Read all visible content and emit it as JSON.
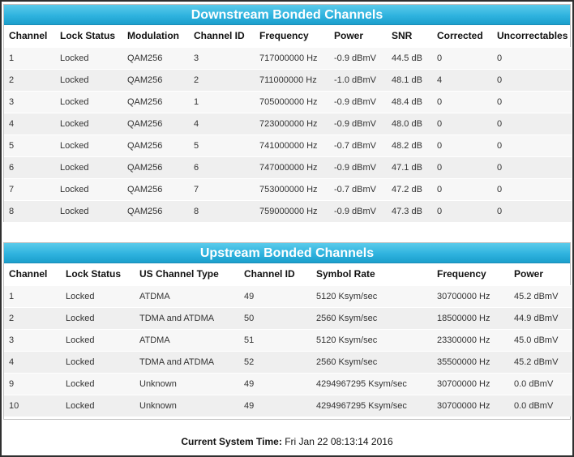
{
  "downstream": {
    "title": "Downstream Bonded Channels",
    "headers": [
      "Channel",
      "Lock Status",
      "Modulation",
      "Channel ID",
      "Frequency",
      "Power",
      "SNR",
      "Corrected",
      "Uncorrectables"
    ],
    "rows": [
      [
        "1",
        "Locked",
        "QAM256",
        "3",
        "717000000 Hz",
        "-0.9 dBmV",
        "44.5 dB",
        "0",
        "0"
      ],
      [
        "2",
        "Locked",
        "QAM256",
        "2",
        "711000000 Hz",
        "-1.0 dBmV",
        "48.1 dB",
        "4",
        "0"
      ],
      [
        "3",
        "Locked",
        "QAM256",
        "1",
        "705000000 Hz",
        "-0.9 dBmV",
        "48.4 dB",
        "0",
        "0"
      ],
      [
        "4",
        "Locked",
        "QAM256",
        "4",
        "723000000 Hz",
        "-0.9 dBmV",
        "48.0 dB",
        "0",
        "0"
      ],
      [
        "5",
        "Locked",
        "QAM256",
        "5",
        "741000000 Hz",
        "-0.7 dBmV",
        "48.2 dB",
        "0",
        "0"
      ],
      [
        "6",
        "Locked",
        "QAM256",
        "6",
        "747000000 Hz",
        "-0.9 dBmV",
        "47.1 dB",
        "0",
        "0"
      ],
      [
        "7",
        "Locked",
        "QAM256",
        "7",
        "753000000 Hz",
        "-0.7 dBmV",
        "47.2 dB",
        "0",
        "0"
      ],
      [
        "8",
        "Locked",
        "QAM256",
        "8",
        "759000000 Hz",
        "-0.9 dBmV",
        "47.3 dB",
        "0",
        "0"
      ]
    ]
  },
  "upstream": {
    "title": "Upstream Bonded Channels",
    "headers": [
      "Channel",
      "Lock Status",
      "US Channel Type",
      "Channel ID",
      "Symbol Rate",
      "Frequency",
      "Power"
    ],
    "rows": [
      [
        "1",
        "Locked",
        "ATDMA",
        "49",
        "5120 Ksym/sec",
        "30700000 Hz",
        "45.2 dBmV"
      ],
      [
        "2",
        "Locked",
        "TDMA and ATDMA",
        "50",
        "2560 Ksym/sec",
        "18500000 Hz",
        "44.9 dBmV"
      ],
      [
        "3",
        "Locked",
        "ATDMA",
        "51",
        "5120 Ksym/sec",
        "23300000 Hz",
        "45.0 dBmV"
      ],
      [
        "4",
        "Locked",
        "TDMA and ATDMA",
        "52",
        "2560 Ksym/sec",
        "35500000 Hz",
        "45.2 dBmV"
      ],
      [
        "9",
        "Locked",
        "Unknown",
        "49",
        "4294967295 Ksym/sec",
        "30700000 Hz",
        "0.0 dBmV"
      ],
      [
        "10",
        "Locked",
        "Unknown",
        "49",
        "4294967295 Ksym/sec",
        "30700000 Hz",
        "0.0 dBmV"
      ]
    ]
  },
  "footer": {
    "label": "Current System Time:",
    "value": "Fri Jan 22 08:13:14 2016"
  },
  "colors": {
    "header_bar": "#2fb3df",
    "frame": "#2f2f2f"
  }
}
